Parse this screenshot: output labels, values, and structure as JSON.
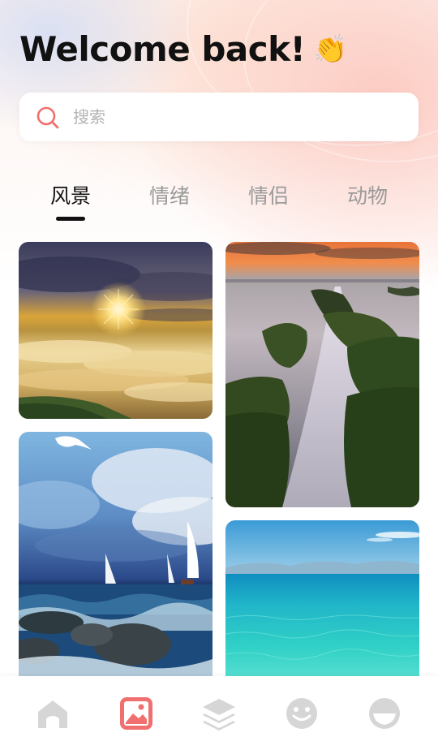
{
  "header": {
    "title": "Welcome back!",
    "emoji": "👏"
  },
  "search": {
    "placeholder": "搜索",
    "value": ""
  },
  "tabs": [
    {
      "label": "风景",
      "active": true
    },
    {
      "label": "情绪",
      "active": false
    },
    {
      "label": "情侣",
      "active": false
    },
    {
      "label": "动物",
      "active": false
    }
  ],
  "gallery": [
    {
      "subject": "sunset-above-clouds"
    },
    {
      "subject": "mossy-rocks-waterfall-sea"
    },
    {
      "subject": "sailboats-stormy-sea"
    },
    {
      "subject": "turquoise-sea"
    }
  ],
  "bottom_nav": [
    {
      "icon": "home-icon",
      "active": false
    },
    {
      "icon": "image-icon",
      "active": true
    },
    {
      "icon": "layers-icon",
      "active": false
    },
    {
      "icon": "smiley-icon",
      "active": false
    },
    {
      "icon": "face-icon",
      "active": false
    }
  ],
  "colors": {
    "accent": "#f06f6f",
    "inactive_icon": "#d6d6d6",
    "tab_inactive": "#9a9a9a",
    "tab_active": "#111111"
  }
}
